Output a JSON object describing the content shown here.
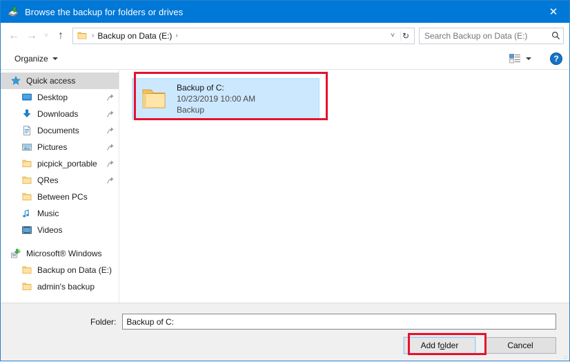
{
  "titlebar": {
    "title": "Browse the backup for folders or drives",
    "icon": "backup-icon",
    "close_label": "✕",
    "bg_color": "#0078D7"
  },
  "navbar": {
    "back_label": "←",
    "forward_label": "→",
    "recent_label": "˅",
    "up_label": "↑",
    "breadcrumb_icon": "folder-icon",
    "separator": "›",
    "crumbs": [
      "Backup on Data (E:)"
    ],
    "trailing_separator": "›",
    "dropdown_label": "˅",
    "refresh_label": "↻",
    "search": {
      "placeholder": "Search Backup on Data (E:)",
      "value": "",
      "icon": "search-icon"
    }
  },
  "toolbar": {
    "organize_label": "Organize",
    "view_icon": "view-layout-icon",
    "view_caret": "▾",
    "help_label": "?"
  },
  "sidebar": {
    "items": [
      {
        "label": "Quick access",
        "icon": "star-icon",
        "level": 0,
        "pinned": false,
        "selected": true
      },
      {
        "label": "Desktop",
        "icon": "desktop-icon",
        "level": 1,
        "pinned": true,
        "selected": false
      },
      {
        "label": "Downloads",
        "icon": "downloads-icon",
        "level": 1,
        "pinned": true,
        "selected": false
      },
      {
        "label": "Documents",
        "icon": "documents-icon",
        "level": 1,
        "pinned": true,
        "selected": false
      },
      {
        "label": "Pictures",
        "icon": "pictures-icon",
        "level": 1,
        "pinned": true,
        "selected": false
      },
      {
        "label": "picpick_portable",
        "icon": "folder-icon",
        "level": 1,
        "pinned": true,
        "selected": false
      },
      {
        "label": "QRes",
        "icon": "folder-icon",
        "level": 1,
        "pinned": true,
        "selected": false
      },
      {
        "label": "Between PCs",
        "icon": "folder-icon",
        "level": 1,
        "pinned": false,
        "selected": false
      },
      {
        "label": "Music",
        "icon": "music-icon",
        "level": 1,
        "pinned": false,
        "selected": false
      },
      {
        "label": "Videos",
        "icon": "videos-icon",
        "level": 1,
        "pinned": false,
        "selected": false
      },
      {
        "label": "",
        "icon": "",
        "level": 0,
        "pinned": false,
        "selected": false,
        "spacer": true
      },
      {
        "label": "Microsoft® Windows",
        "icon": "windows-backup-icon",
        "level": 0,
        "pinned": false,
        "selected": false
      },
      {
        "label": "Backup on Data (E:)",
        "icon": "folder-icon",
        "level": 1,
        "pinned": false,
        "selected": false
      },
      {
        "label": "admin's backup",
        "icon": "folder-icon",
        "level": 1,
        "pinned": false,
        "selected": false
      }
    ]
  },
  "content": {
    "files": [
      {
        "name": "Backup of C:",
        "date": "10/23/2019 10:00 AM",
        "type": "Backup",
        "icon": "folder-icon",
        "selected": true
      }
    ]
  },
  "bottom": {
    "folder_label": "Folder:",
    "folder_value": "Backup of C:",
    "folder_placeholder": "",
    "add_folder_prefix": "Add f",
    "add_folder_accel": "o",
    "add_folder_suffix": "lder",
    "cancel_label": "Cancel"
  },
  "annotations": {
    "color": "#E8112D",
    "boxes": [
      "selected-file-item",
      "add-folder-button"
    ]
  }
}
